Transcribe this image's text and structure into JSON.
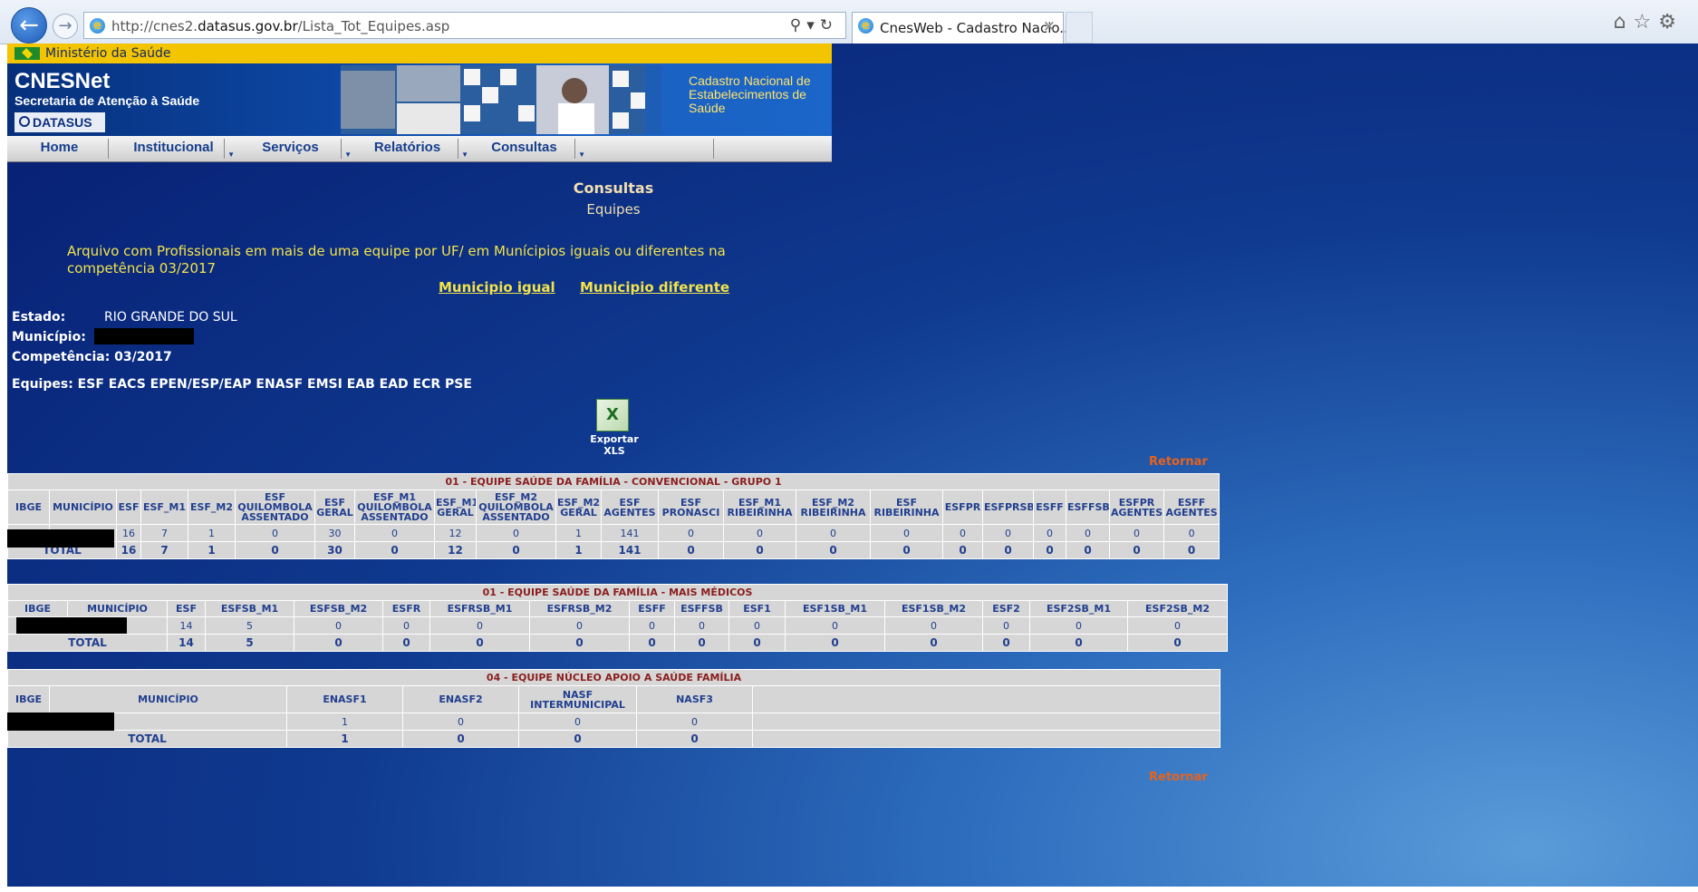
{
  "browser": {
    "url_prefix": "http://cnes2.",
    "url_domain": "datasus.gov.br",
    "url_path": "/Lista_Tot_Equipes.asp",
    "tab_title": "CnesWeb - Cadastro Nacio..."
  },
  "header": {
    "ministry": "Ministério da Saúde",
    "brand_title": "CNESNet",
    "brand_subtitle": "Secretaria de Atenção à Saúde",
    "logo_text": "DATASUS",
    "caption": "Cadastro Nacional de Estabelecimentos de Saúde"
  },
  "menu": [
    {
      "label": "Home"
    },
    {
      "label": "Institucional"
    },
    {
      "label": "Serviços"
    },
    {
      "label": "Relatórios"
    },
    {
      "label": "Consultas"
    }
  ],
  "page": {
    "title": "Consultas",
    "subtitle": "Equipes",
    "notice": "Arquivo com Profissionais em mais de uma equipe por UF/ em Munícipios iguais ou diferentes na competência 03/2017",
    "link_same": "Municipio igual",
    "link_diff": "Municipio diferente",
    "estado_label": "Estado:",
    "estado_value": "RIO GRANDE DO SUL",
    "municipio_label": "Município:",
    "competencia": "Competência: 03/2017",
    "equipes": "Equipes: ESF EACS EPEN/ESP/EAP ENASF EMSI EAB EAD ECR PSE",
    "export_label": "Exportar XLS",
    "return_label": "Retornar"
  },
  "table1": {
    "caption": "01 - EQUIPE SAÚDE DA FAMÍLIA - CONVENCIONAL - GRUPO 1",
    "headers": [
      "IBGE",
      "MUNICÍPIO",
      "ESF",
      "ESF_M1",
      "ESF_M2",
      "ESF QUILOMBOLA ASSENTADO",
      "ESF GERAL",
      "ESF_M1 QUILOMBOLA ASSENTADO",
      "ESF_M1 GERAL",
      "ESF_M2 QUILOMBOLA ASSENTADO",
      "ESF_M2 GERAL",
      "ESF AGENTES",
      "ESF PRONASCI",
      "ESF_M1 RIBEIRINHA",
      "ESF_M2 RIBEIRINHA",
      "ESF RIBEIRINHA",
      "ESFPR",
      "ESFPRSB",
      "ESFF",
      "ESFFSB",
      "ESFPR AGENTES",
      "ESFF AGENTES"
    ],
    "row": [
      "16",
      "7",
      "1",
      "0",
      "30",
      "0",
      "12",
      "0",
      "1",
      "141",
      "0",
      "0",
      "0",
      "0",
      "0",
      "0",
      "0",
      "0",
      "0",
      "0"
    ],
    "total_label": "TOTAL",
    "totals": [
      "16",
      "7",
      "1",
      "0",
      "30",
      "0",
      "12",
      "0",
      "1",
      "141",
      "0",
      "0",
      "0",
      "0",
      "0",
      "0",
      "0",
      "0",
      "0",
      "0"
    ]
  },
  "table2": {
    "caption": "01 - EQUIPE SAÚDE DA FAMÍLIA - MAIS MÉDICOS",
    "headers": [
      "IBGE",
      "MUNICÍPIO",
      "ESF",
      "ESFSB_M1",
      "ESFSB_M2",
      "ESFR",
      "ESFRSB_M1",
      "ESFRSB_M2",
      "ESFF",
      "ESFFSB",
      "ESF1",
      "ESF1SB_M1",
      "ESF1SB_M2",
      "ESF2",
      "ESF2SB_M1",
      "ESF2SB_M2"
    ],
    "row": [
      "14",
      "5",
      "0",
      "0",
      "0",
      "0",
      "0",
      "0",
      "0",
      "0",
      "0",
      "0",
      "0",
      "0"
    ],
    "total_label": "TOTAL",
    "totals": [
      "14",
      "5",
      "0",
      "0",
      "0",
      "0",
      "0",
      "0",
      "0",
      "0",
      "0",
      "0",
      "0",
      "0"
    ]
  },
  "table3": {
    "caption": "04 - EQUIPE NÚCLEO APOIO A SAÚDE FAMÍLIA",
    "headers": [
      "IBGE",
      "MUNICÍPIO",
      "ENASF1",
      "ENASF2",
      "NASF INTERMUNICIPAL",
      "NASF3"
    ],
    "row": [
      "1",
      "0",
      "0",
      "0"
    ],
    "total_label": "TOTAL",
    "totals": [
      "1",
      "0",
      "0",
      "0"
    ]
  }
}
